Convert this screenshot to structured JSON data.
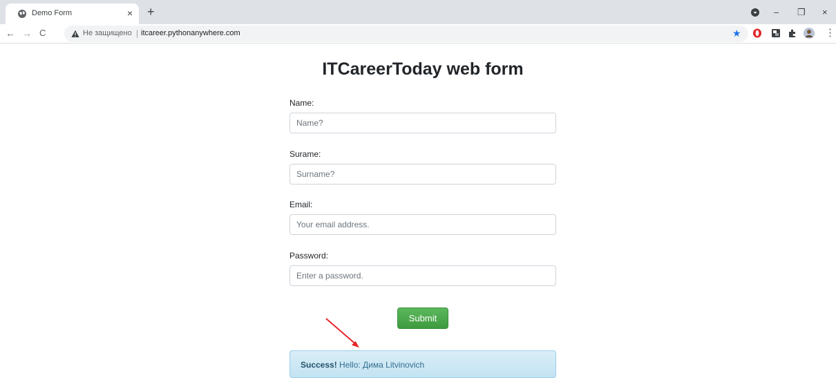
{
  "browser": {
    "tab_title": "Demo Form",
    "tab_close": "×",
    "new_tab": "+",
    "back": "←",
    "forward": "→",
    "reload": "C",
    "security_label": "Не защищено",
    "url_separator": "|",
    "url": "itcareer.pythonanywhere.com",
    "star": "★",
    "window_minimize": "–",
    "window_restore": "❐",
    "window_close": "×",
    "menu": "⋮",
    "accent_color": "#1a73e8"
  },
  "page": {
    "title": "ITCareerToday web form",
    "fields": [
      {
        "label": "Name:",
        "placeholder": "Name?"
      },
      {
        "label": "Surame:",
        "placeholder": "Surname?"
      },
      {
        "label": "Email:",
        "placeholder": "Your email address."
      },
      {
        "label": "Password:",
        "placeholder": "Enter a password."
      }
    ],
    "submit_label": "Submit",
    "alert": {
      "strong": "Success!",
      "message": " Hello: Дима Litvinovich"
    },
    "colors": {
      "submit": "#4cae4c",
      "alert_bg": "#d9edf7",
      "arrow": "#e8262a"
    }
  }
}
